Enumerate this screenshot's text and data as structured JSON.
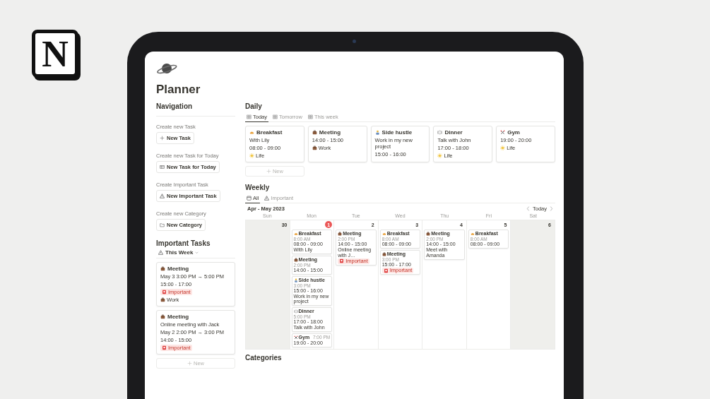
{
  "logo": {
    "text": "N"
  },
  "page": {
    "title": "Planner"
  },
  "navigation": {
    "title": "Navigation",
    "actions": [
      {
        "label": "Create new Task",
        "button": "New Task",
        "kind": "plus"
      },
      {
        "label": "Create new Task for Today",
        "button": "New Task for Today",
        "kind": "today"
      },
      {
        "label": "Create Important Task",
        "button": "New Important Task",
        "kind": "important"
      },
      {
        "label": "Create new Category",
        "button": "New Category",
        "kind": "category"
      }
    ]
  },
  "important_tasks": {
    "title": "Important Tasks",
    "filter": "This Week",
    "cards": [
      {
        "kind": "meeting",
        "title": "Meeting",
        "lines": [
          "May 3 3:00 PM → 5:00 PM",
          "15:00 - 17:00"
        ],
        "tags": [
          {
            "label": "Important",
            "kind": "important"
          },
          {
            "label": "Work",
            "kind": "work"
          }
        ]
      },
      {
        "kind": "meeting",
        "title": "Meeting",
        "lines": [
          "Online meeting with Jack",
          "May 2 2:00 PM → 3:00 PM",
          "14:00 - 15:00"
        ],
        "tags": [
          {
            "label": "Important",
            "kind": "important"
          }
        ]
      }
    ],
    "new_button": "New"
  },
  "daily": {
    "title": "Daily",
    "tabs": [
      {
        "label": "Today",
        "selected": true
      },
      {
        "label": "Tomorrow",
        "selected": false
      },
      {
        "label": "This week",
        "selected": false
      }
    ],
    "cards": [
      {
        "kind": "breakfast",
        "title": "Breakfast",
        "lines": [
          "With Lily",
          "08:00 - 09:00"
        ],
        "tags": [
          {
            "label": "Life",
            "kind": "life"
          }
        ]
      },
      {
        "kind": "meeting",
        "title": "Meeting",
        "lines": [
          "14:00 - 15:00"
        ],
        "tags": [
          {
            "label": "Work",
            "kind": "work"
          }
        ]
      },
      {
        "kind": "hustle",
        "title": "Side hustle",
        "lines": [
          "Work in my new project",
          "15:00 - 16:00"
        ]
      },
      {
        "kind": "dinner",
        "title": "Dinner",
        "lines": [
          "Talk with John",
          "17:00 - 18:00"
        ],
        "tags": [
          {
            "label": "Life",
            "kind": "life"
          }
        ]
      },
      {
        "kind": "gym",
        "title": "Gym",
        "lines": [
          "19:00 - 20:00"
        ],
        "tags": [
          {
            "label": "Life",
            "kind": "life"
          }
        ]
      }
    ],
    "new_button": "New"
  },
  "weekly": {
    "title": "Weekly",
    "tabs": [
      {
        "label": "All",
        "selected": true,
        "kind": "calendar"
      },
      {
        "label": "Important",
        "selected": false,
        "kind": "important"
      }
    ],
    "range": "Apr - May 2023",
    "today_button": "Today",
    "weekdays": [
      "Sun",
      "Mon",
      "Tue",
      "Wed",
      "Thu",
      "Fri",
      "Sat"
    ],
    "days": [
      {
        "date": "30",
        "weekend": true,
        "today": false
      },
      {
        "date": "1",
        "weekend": false,
        "today": true,
        "events": [
          {
            "kind": "breakfast",
            "title": "Breakfast",
            "time": "8:00 AM",
            "lines": [
              "08:00 - 09:00",
              "With Lily"
            ]
          },
          {
            "kind": "meeting",
            "title": "Meeting",
            "time": "2:00 PM",
            "lines": [
              "14:00 - 15:00"
            ]
          },
          {
            "kind": "hustle",
            "title": "Side hustle",
            "time": "3:00 PM",
            "lines": [
              "15:00 - 16:00",
              "Work in my new project"
            ]
          },
          {
            "kind": "dinner",
            "title": "Dinner",
            "time": "5:00 PM",
            "lines": [
              "17:00 - 18:00",
              "Talk with John"
            ]
          },
          {
            "kind": "gym",
            "title": "Gym",
            "time": "7:00 PM",
            "lines": [
              "19:00 - 20:00"
            ]
          }
        ]
      },
      {
        "date": "2",
        "weekend": false,
        "today": false,
        "events": [
          {
            "kind": "meeting",
            "title": "Meeting",
            "time": "2:00 PM",
            "lines": [
              "14:00 - 15:00",
              "Online meeting with J…"
            ],
            "tags": [
              {
                "label": "Important",
                "kind": "important"
              }
            ]
          }
        ]
      },
      {
        "date": "3",
        "weekend": false,
        "today": false,
        "events": [
          {
            "kind": "breakfast",
            "title": "Breakfast",
            "time": "8:00 AM",
            "lines": [
              "08:00 - 09:00"
            ]
          },
          {
            "kind": "meeting",
            "title": "Meeting",
            "time": "3:00 PM",
            "lines": [
              "15:00 - 17:00"
            ],
            "tags": [
              {
                "label": "Important",
                "kind": "important"
              }
            ]
          }
        ]
      },
      {
        "date": "4",
        "weekend": false,
        "today": false,
        "events": [
          {
            "kind": "meeting",
            "title": "Meeting",
            "time": "2:00 PM",
            "lines": [
              "14:00 - 15:00",
              "Meet with Amanda"
            ]
          }
        ]
      },
      {
        "date": "5",
        "weekend": false,
        "today": false,
        "events": [
          {
            "kind": "breakfast",
            "title": "Breakfast",
            "time": "8:00 AM",
            "lines": [
              "08:00 - 09:00"
            ]
          }
        ]
      },
      {
        "date": "6",
        "weekend": true,
        "today": false
      }
    ]
  },
  "categories": {
    "title": "Categories"
  }
}
